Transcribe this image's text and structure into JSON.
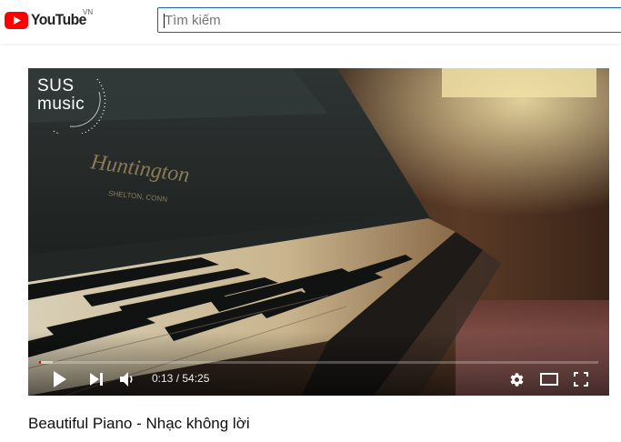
{
  "app": {
    "logo_text": "YouTube",
    "country_code": "VN",
    "brand_color": "#ff0000"
  },
  "search": {
    "placeholder": "Tìm kiếm",
    "value": "",
    "icon": "search-field"
  },
  "player": {
    "channel_watermark": {
      "line1": "SUS",
      "line2": "music"
    },
    "logo_text_on_piano": "Huntington",
    "logo_subtext_on_piano": "SHELTON, CONN",
    "current_time": "0:13",
    "duration": "54:25",
    "time_display": "0:13 / 54:25",
    "progress_fraction": 0.004,
    "loaded_fraction": 0.025,
    "icons": {
      "play": "play-icon",
      "next": "next-icon",
      "volume": "volume-icon",
      "settings": "gear-icon",
      "theater": "theater-mode-icon",
      "fullscreen": "fullscreen-icon"
    }
  },
  "video": {
    "title": "Beautiful Piano - Nhạc không lời"
  }
}
